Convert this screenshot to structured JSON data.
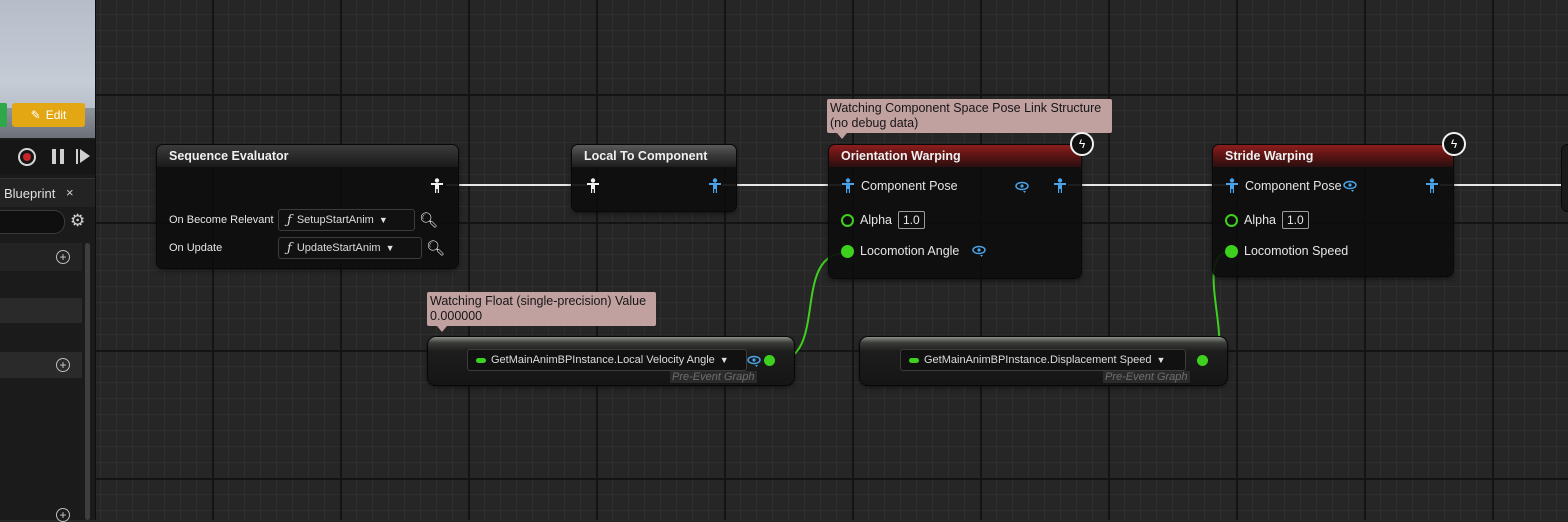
{
  "left_panel": {
    "edit_label": "Edit",
    "tab_label": "Blueprint",
    "tab_close": "×"
  },
  "nodes": {
    "sequence_evaluator": {
      "title": "Sequence Evaluator",
      "on_become_relevant_label": "On Become Relevant",
      "on_become_relevant_value": "SetupStartAnim",
      "on_update_label": "On Update",
      "on_update_value": "UpdateStartAnim"
    },
    "local_to_component": {
      "title": "Local To Component"
    },
    "orientation_warping": {
      "title": "Orientation Warping",
      "component_pose": "Component Pose",
      "alpha_label": "Alpha",
      "alpha_value": "1.0",
      "locomotion_angle": "Locomotion Angle"
    },
    "stride_warping": {
      "title": "Stride Warping",
      "component_pose": "Component Pose",
      "alpha_label": "Alpha",
      "alpha_value": "1.0",
      "locomotion_speed": "Locomotion Speed"
    }
  },
  "getters": {
    "velocity_angle": {
      "label": "GetMainAnimBPInstance.Local Velocity Angle",
      "note": "Pre-Event Graph"
    },
    "displacement_speed": {
      "label": "GetMainAnimBPInstance.Displacement Speed",
      "note": "Pre-Event Graph"
    }
  },
  "tooltips": {
    "pose_watch_line1": "Watching Component Space Pose Link Structure",
    "pose_watch_line2": "(no debug data)",
    "float_watch_line1": "Watching Float (single-precision) Value",
    "float_watch_line2": "0.000000"
  },
  "colors": {
    "float_pin": "#3ed01e",
    "pose_pin": "#4aa3e8",
    "edit_button": "#e3a714",
    "node_header_red": "#8e1d1d"
  }
}
